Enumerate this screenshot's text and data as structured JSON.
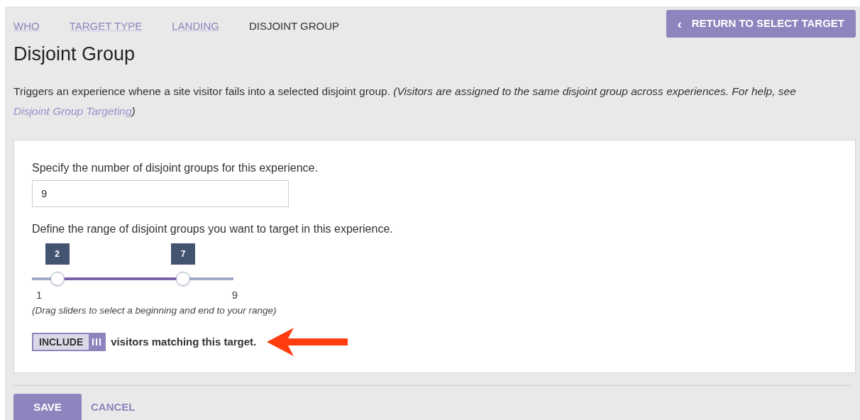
{
  "breadcrumbs": [
    {
      "label": "WHO",
      "selected": false
    },
    {
      "label": "TARGET TYPE",
      "selected": false
    },
    {
      "label": "LANDING",
      "selected": false
    },
    {
      "label": "DISJOINT GROUP",
      "selected": true
    }
  ],
  "return_button": {
    "icon": "‹",
    "label": "RETURN TO SELECT TARGET"
  },
  "title": "Disjoint Group",
  "description": {
    "text": "Triggers an experience whene a site visitor fails into a selected disjoint group.",
    "note": "(Visitors are assigned to the same disjoint group across experiences. For help, see",
    "link": "Disjoint Group Targeting",
    "note_end": ")"
  },
  "count_field": {
    "label": "Specify the number of disjoint groups for this experience.",
    "value": "9"
  },
  "range": {
    "label": "Define the range of disjoint groups you want to target in this experience.",
    "thumbs": [
      {
        "reading": "2",
        "level": 0.125
      },
      {
        "reading": "7",
        "level": 0.75
      }
    ],
    "min_label": "1",
    "max_label": "9",
    "hint": "(Drag sliders to select a beginning and end to your range)"
  },
  "include_toggle": {
    "label": "INCLUDE",
    "on": true,
    "suffix": "visitors matching this target."
  },
  "buttons": [
    {
      "kind": "primary",
      "label": "SAVE"
    },
    {
      "kind": "link",
      "label": "CANCEL"
    }
  ]
}
